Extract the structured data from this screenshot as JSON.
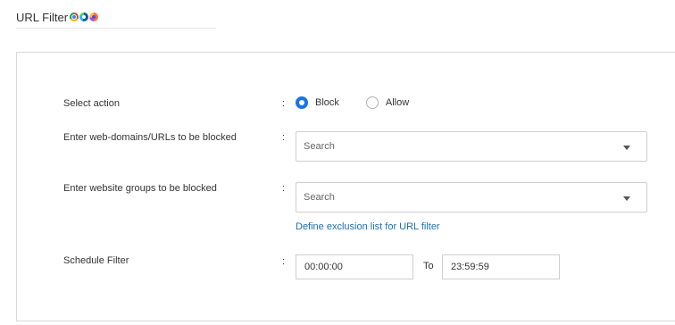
{
  "header": {
    "title": "URL Filter",
    "browser_icons": [
      "chrome-icon",
      "edge-icon",
      "firefox-icon"
    ]
  },
  "form": {
    "select_action": {
      "label": "Select action",
      "colon": ":",
      "options": [
        {
          "label": "Block",
          "selected": true
        },
        {
          "label": "Allow",
          "selected": false
        }
      ]
    },
    "domains": {
      "label": "Enter web-domains/URLs to be blocked",
      "colon": ":",
      "placeholder": "Search"
    },
    "groups": {
      "label": "Enter website groups to be blocked",
      "colon": ":",
      "placeholder": "Search"
    },
    "exclusion_link": "Define exclusion list for URL filter",
    "schedule": {
      "label": "Schedule Filter",
      "colon": ":",
      "from": "00:00:00",
      "to_label": "To",
      "to": "23:59:59"
    }
  },
  "colors": {
    "accent": "#1a73e8",
    "link": "#1a6fb5",
    "border": "#d9d9d9"
  }
}
